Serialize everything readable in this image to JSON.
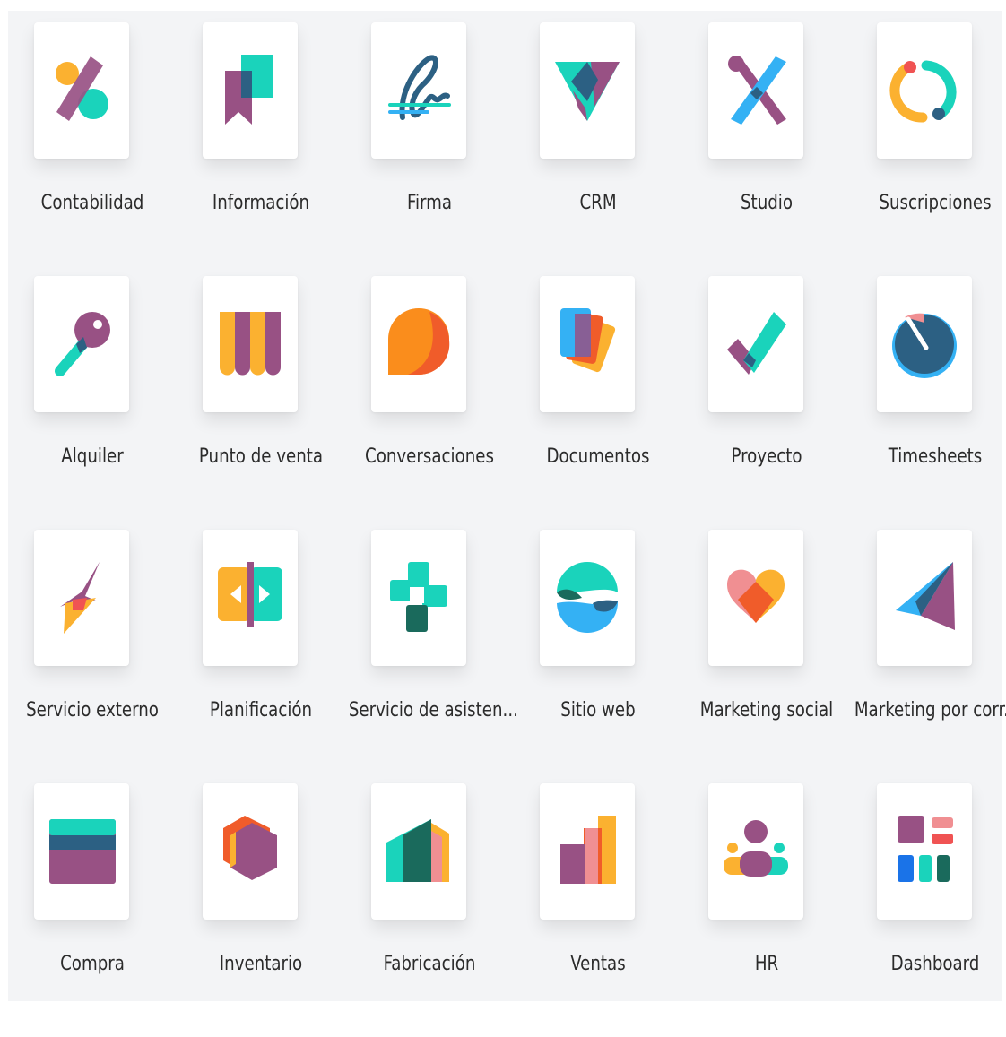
{
  "apps": [
    {
      "name": "Contabilidad",
      "icon": "accounting-icon"
    },
    {
      "name": "Información",
      "icon": "knowledge-icon"
    },
    {
      "name": "Firma",
      "icon": "sign-icon"
    },
    {
      "name": "CRM",
      "icon": "crm-icon"
    },
    {
      "name": "Studio",
      "icon": "studio-icon"
    },
    {
      "name": "Suscripciones",
      "icon": "subscriptions-icon"
    },
    {
      "name": "Alquiler",
      "icon": "rental-icon"
    },
    {
      "name": "Punto de venta",
      "icon": "point-of-sale-icon"
    },
    {
      "name": "Conversaciones",
      "icon": "discuss-icon"
    },
    {
      "name": "Documentos",
      "icon": "documents-icon"
    },
    {
      "name": "Proyecto",
      "icon": "project-icon"
    },
    {
      "name": "Timesheets",
      "icon": "timesheets-icon"
    },
    {
      "name": "Servicio externo",
      "icon": "field-service-icon"
    },
    {
      "name": "Planificación",
      "icon": "planning-icon"
    },
    {
      "name": "Servicio de asisten...",
      "icon": "helpdesk-icon"
    },
    {
      "name": "Sitio web",
      "icon": "website-icon"
    },
    {
      "name": "Marketing social",
      "icon": "social-marketing-icon"
    },
    {
      "name": "Marketing por corr...",
      "icon": "email-marketing-icon"
    },
    {
      "name": "Compra",
      "icon": "purchase-icon"
    },
    {
      "name": "Inventario",
      "icon": "inventory-icon"
    },
    {
      "name": "Fabricación",
      "icon": "manufacturing-icon"
    },
    {
      "name": "Ventas",
      "icon": "sales-icon"
    },
    {
      "name": "HR",
      "icon": "hr-icon"
    },
    {
      "name": "Dashboard",
      "icon": "dashboard-icon"
    }
  ],
  "colors": {
    "purple": "#985184",
    "teal": "#1ad3bb",
    "orange": "#fbb130",
    "red": "#f05353",
    "dark_blue": "#2c6083",
    "light_blue": "#34b1f4",
    "background": "#f3f4f6"
  }
}
